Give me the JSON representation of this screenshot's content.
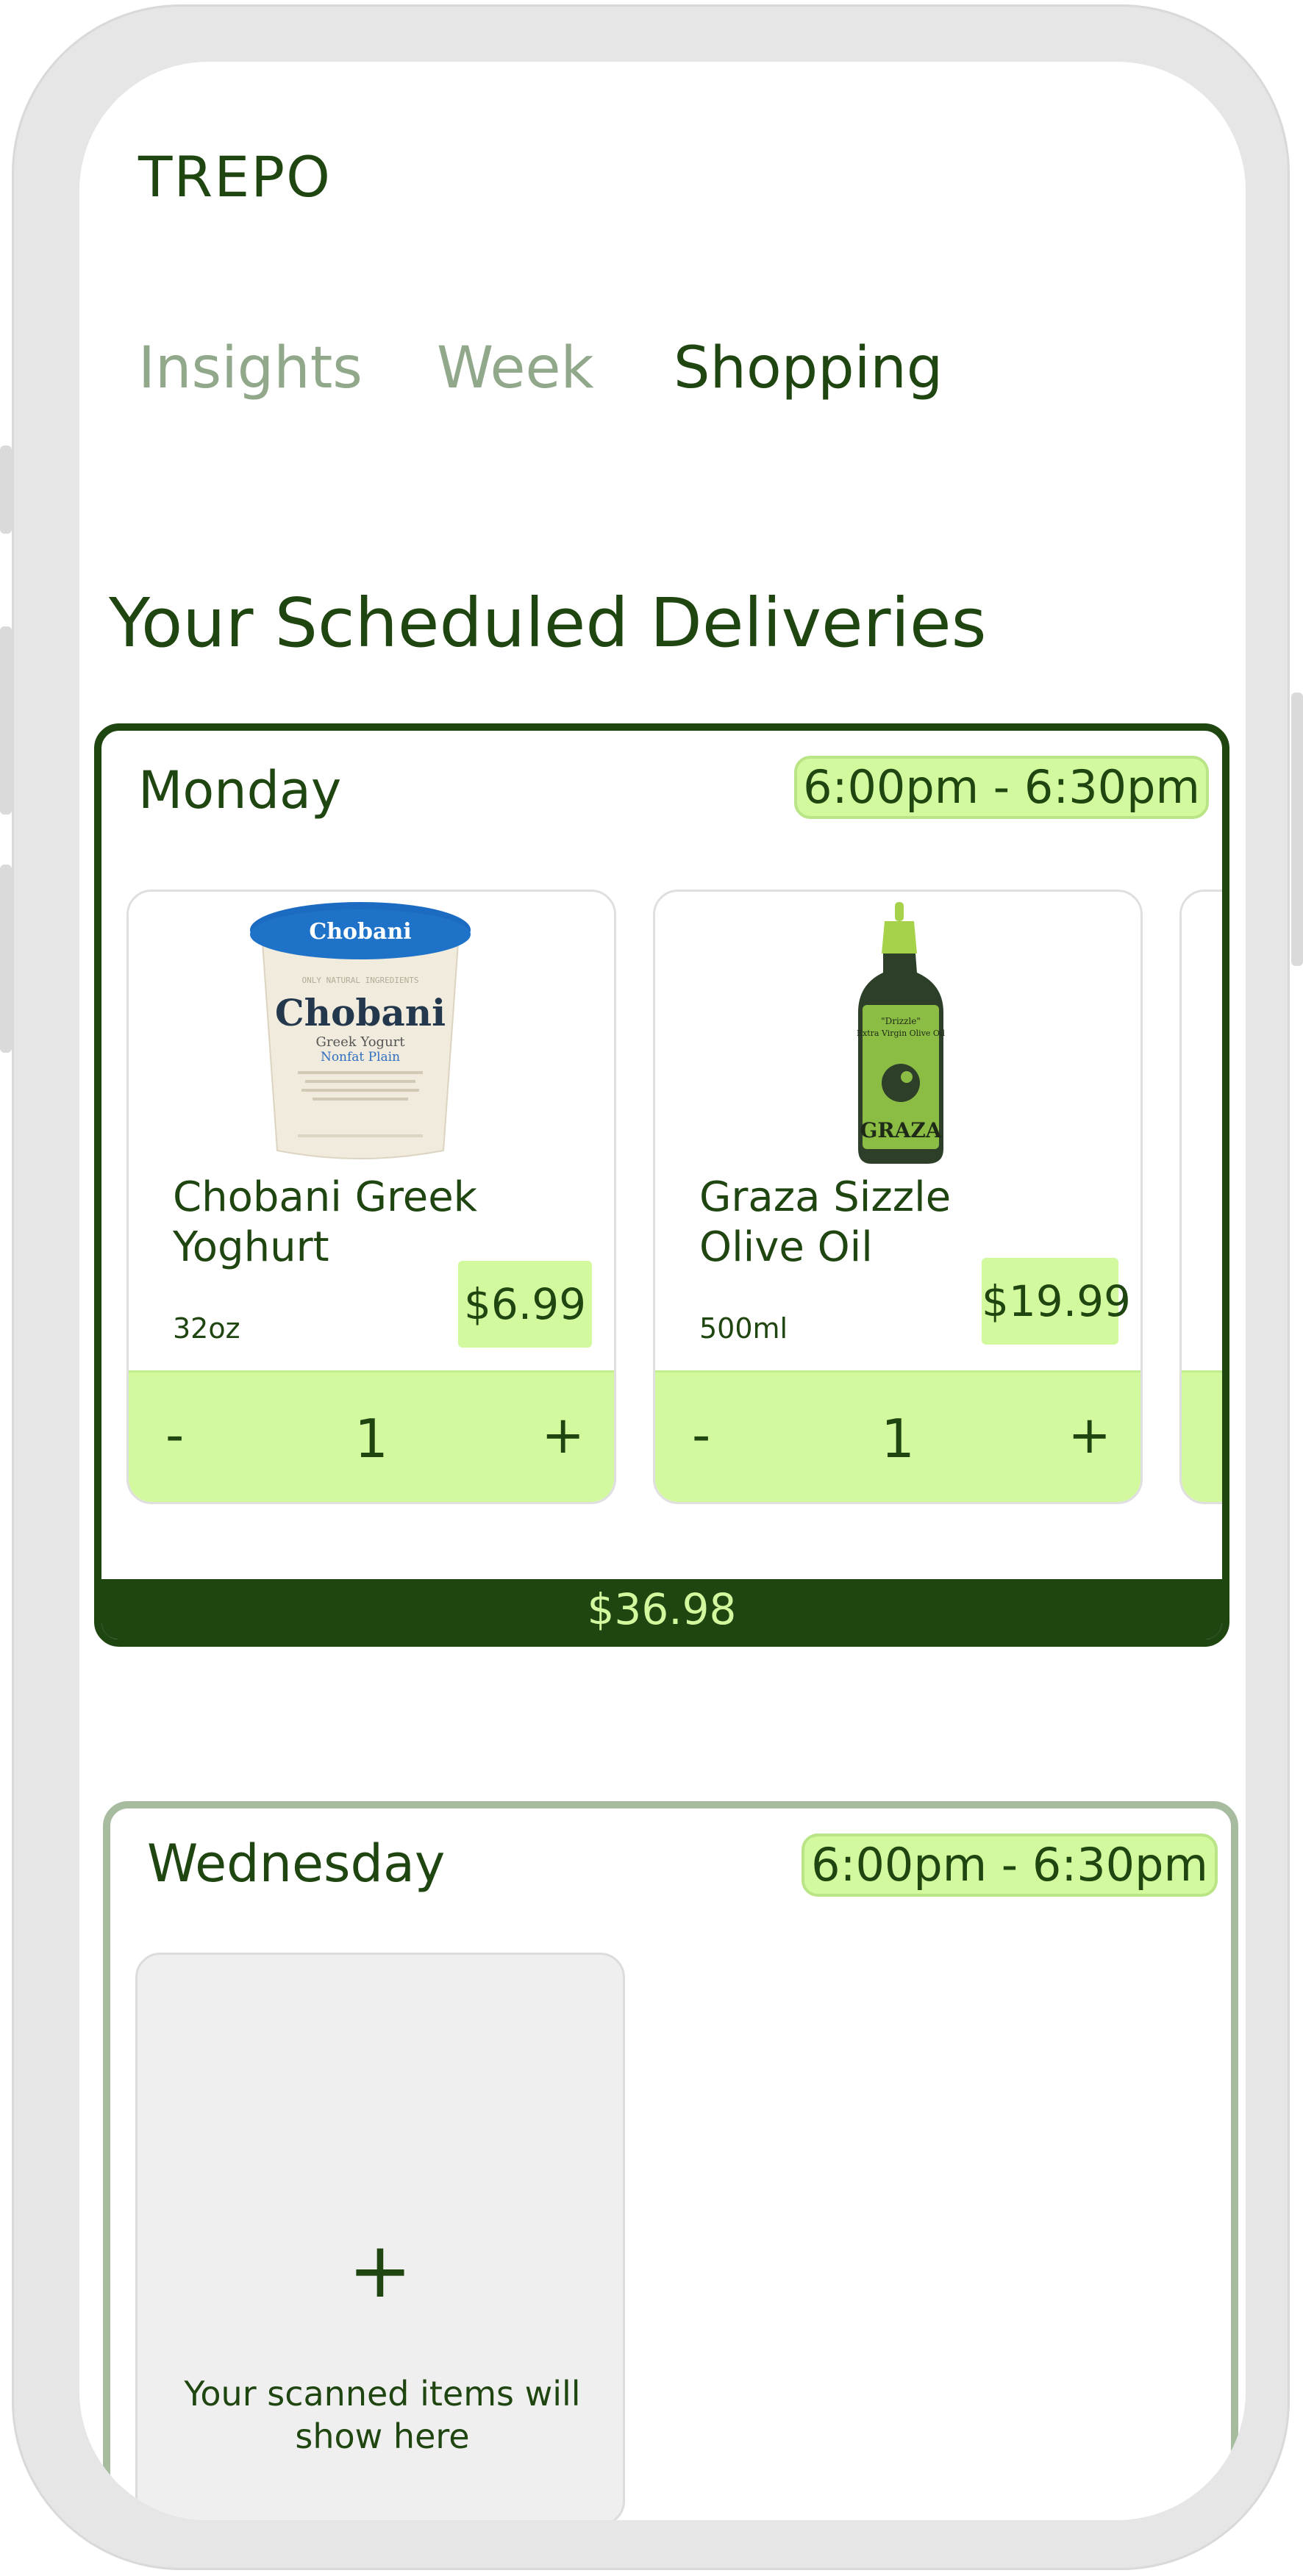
{
  "app": {
    "brand": "TREPO"
  },
  "tabs": [
    {
      "label": "Insights",
      "active": false
    },
    {
      "label": "Week",
      "active": false
    },
    {
      "label": "Shopping",
      "active": true
    }
  ],
  "page_title": "Your Scheduled Deliveries",
  "colors": {
    "brand_dark_green": "#1f4510",
    "accent_lime": "#d3f99f",
    "inactive_tab": "#91a88a",
    "pending_border": "#a7bc9f"
  },
  "deliveries": [
    {
      "day": "Monday",
      "time_window": "6:00pm - 6:30pm",
      "items": [
        {
          "name": "Chobani Greek Yoghurt",
          "size": "32oz",
          "price": "$6.99",
          "qty": "1",
          "image": "chobani-yogurt-tub",
          "minus": "-",
          "plus": "+"
        },
        {
          "name": "Graza Sizzle Olive Oil",
          "size": "500ml",
          "price": "$19.99",
          "qty": "1",
          "image": "graza-olive-oil-bottle",
          "minus": "-",
          "plus": "+"
        }
      ],
      "total": "$36.98"
    },
    {
      "day": "Wednesday",
      "time_window": "6:00pm - 6:30pm",
      "empty_state": {
        "plus": "+",
        "message": "Your scanned items will show here"
      }
    }
  ]
}
